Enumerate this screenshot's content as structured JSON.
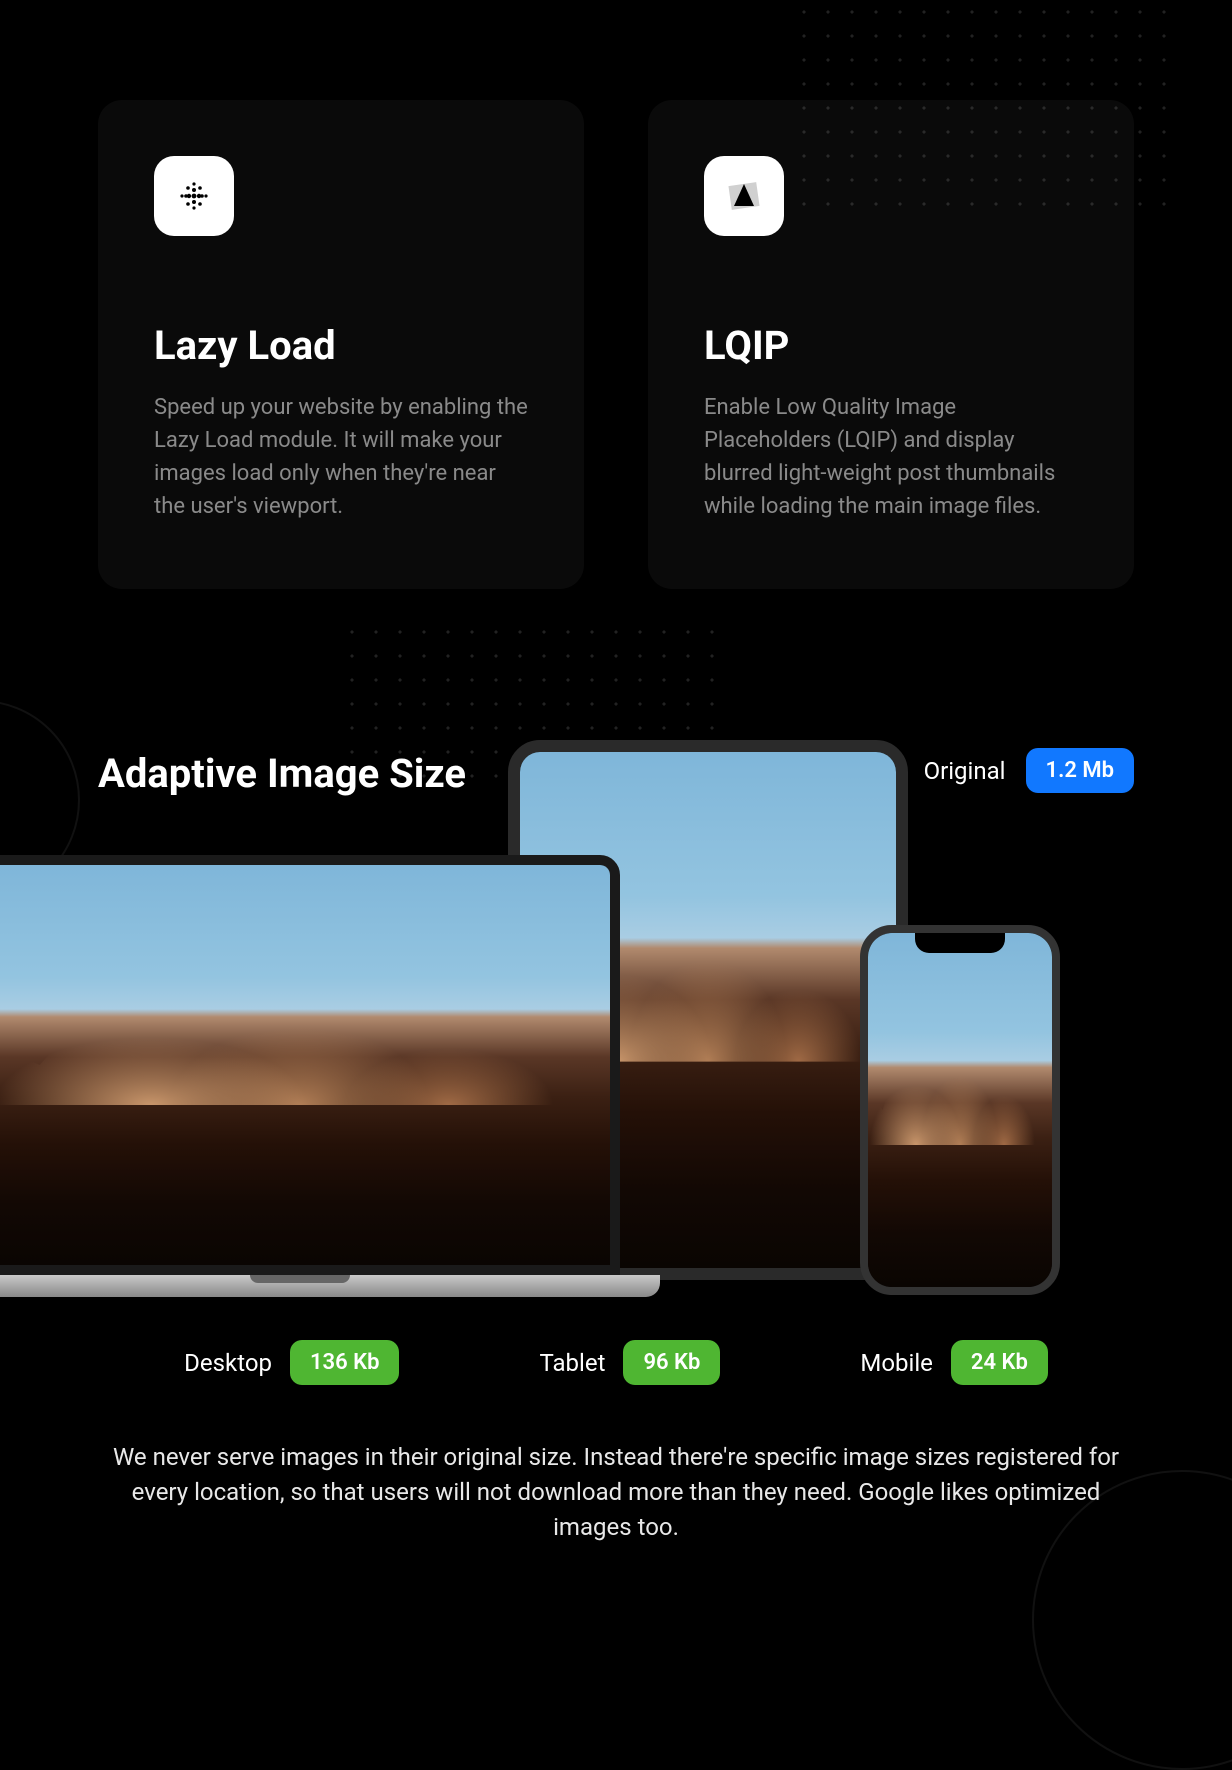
{
  "cards": [
    {
      "title": "Lazy Load",
      "description": "Speed up your website by enabling the Lazy Load module. It will make your images load only when they're near the user's viewport."
    },
    {
      "title": "LQIP",
      "description": "Enable Low Quality Image Placeholders (LQIP) and display blurred light-weight post thumbnails while loading the main image files."
    }
  ],
  "adaptive": {
    "title": "Adaptive Image Size",
    "original_label": "Original",
    "original_size": "1.2 Mb",
    "sizes": [
      {
        "label": "Desktop",
        "value": "136 Kb"
      },
      {
        "label": "Tablet",
        "value": "96 Kb"
      },
      {
        "label": "Mobile",
        "value": "24 Kb"
      }
    ],
    "paragraph": "We never serve images in their original size. Instead there're specific image sizes registered for every location, so that users will not download more than they need. Google likes optimized images too."
  }
}
